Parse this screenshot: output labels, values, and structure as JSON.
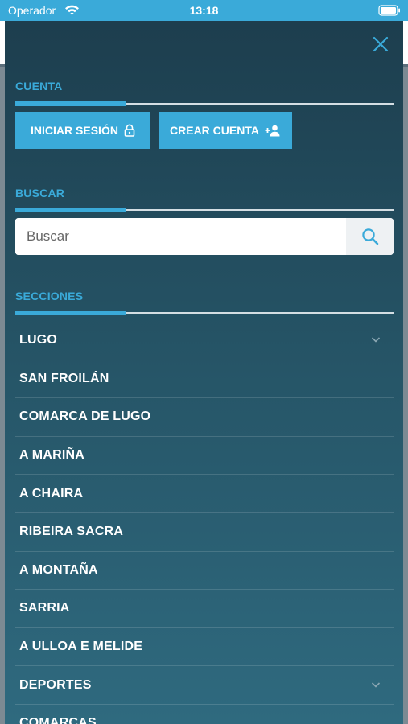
{
  "status_bar": {
    "carrier": "Operador",
    "time": "13:18"
  },
  "menu": {
    "account": {
      "title": "CUENTA",
      "login_label": "INICIAR SESIÓN",
      "register_label": "CREAR CUENTA"
    },
    "search": {
      "title": "BUSCAR",
      "placeholder": "Buscar"
    },
    "sections": {
      "title": "SECCIONES",
      "items": [
        {
          "label": "LUGO",
          "expandable": true
        },
        {
          "label": "SAN FROILÁN",
          "expandable": false
        },
        {
          "label": "COMARCA DE LUGO",
          "expandable": false
        },
        {
          "label": "A MARIÑA",
          "expandable": false
        },
        {
          "label": "A CHAIRA",
          "expandable": false
        },
        {
          "label": "RIBEIRA SACRA",
          "expandable": false
        },
        {
          "label": "A MONTAÑA",
          "expandable": false
        },
        {
          "label": "SARRIA",
          "expandable": false
        },
        {
          "label": "A ULLOA E MELIDE",
          "expandable": false
        },
        {
          "label": "DEPORTES",
          "expandable": true
        },
        {
          "label": "COMARCAS",
          "expandable": false
        }
      ]
    }
  },
  "colors": {
    "accent": "#3aaad9",
    "drawer_top": "#1d3e4e",
    "drawer_bottom": "#2f6a7f"
  },
  "icons": {
    "close": "close-icon",
    "lock": "lock-icon",
    "add_user": "add-user-icon",
    "search": "search-icon",
    "expand": "chevron-down-icon"
  }
}
